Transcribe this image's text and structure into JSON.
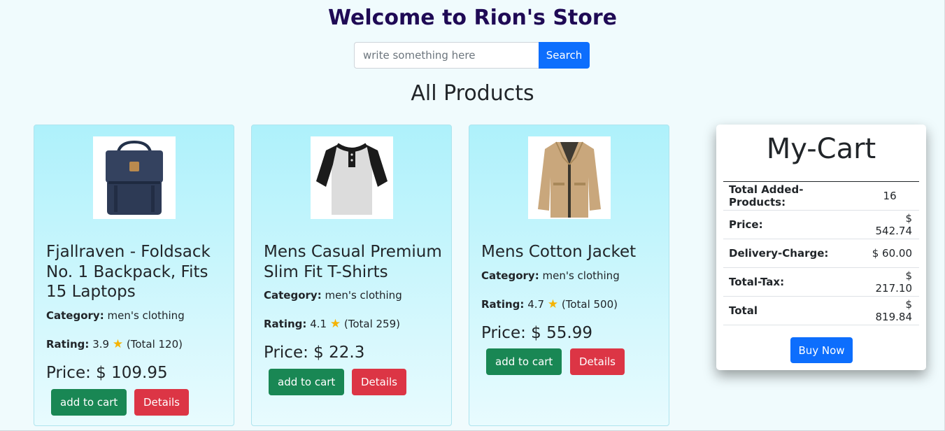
{
  "header": {
    "title": "Welcome to Rion's Store"
  },
  "search": {
    "placeholder": "write something here",
    "value": "",
    "button_label": "Search"
  },
  "section": {
    "title": "All Products"
  },
  "labels": {
    "category": "Category:",
    "rating": "Rating:",
    "price_prefix": "Price: $",
    "add_to_cart": "add to cart",
    "details": "Details"
  },
  "products": [
    {
      "title": "Fjallraven - Foldsack No. 1 Backpack, Fits 15 Laptops",
      "category": "men's clothing",
      "rating": "3.9",
      "rating_total": "(Total 120)",
      "price": "109.95",
      "image_icon": "backpack-image"
    },
    {
      "title": "Mens Casual Premium Slim Fit T-Shirts",
      "category": "men's clothing",
      "rating": "4.1",
      "rating_total": "(Total 259)",
      "price": "22.3",
      "image_icon": "tshirt-image"
    },
    {
      "title": "Mens Cotton Jacket",
      "category": "men's clothing",
      "rating": "4.7",
      "rating_total": "(Total 500)",
      "price": "55.99",
      "image_icon": "jacket-image"
    }
  ],
  "cart": {
    "title": "My-Cart",
    "rows": [
      {
        "label": "Total Added-Products:",
        "value": "16"
      },
      {
        "label": "Price:",
        "value": "$ 542.74"
      },
      {
        "label": "Delivery-Charge:",
        "value": "$ 60.00"
      },
      {
        "label": "Total-Tax:",
        "value": "$ 217.10"
      },
      {
        "label": "Total",
        "value": "$ 819.84"
      }
    ],
    "buy_label": "Buy Now"
  },
  "colors": {
    "title": "#1f0a55",
    "primary": "#0d6efd",
    "success": "#198754",
    "danger": "#dc3545",
    "star": "#f5b301",
    "card_gradient_top": "#aef1fb"
  },
  "icons": {
    "rating_star": "star-icon"
  }
}
